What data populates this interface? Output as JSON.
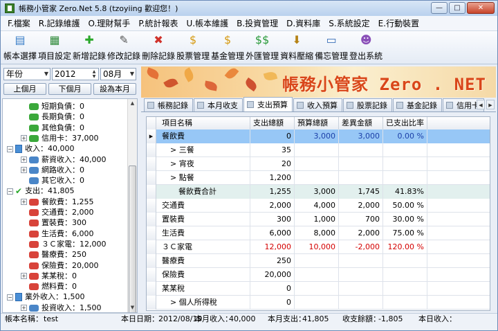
{
  "window": {
    "title": "帳務小管家 Zero.Net 5.8 (tzoyiing 歡迎您！)",
    "buttons": {
      "minimize": "—",
      "maximize": "□",
      "close": "✕"
    }
  },
  "menu": [
    "F.檔案",
    "R.記錄維護",
    "O.理財幫手",
    "P.統計報表",
    "U.帳本維護",
    "B.投資管理",
    "D.資料庫",
    "S.系統設定",
    "E.行動裝置"
  ],
  "toolbar": [
    {
      "label": "帳本選擇",
      "icon": "ledger-icon",
      "glyph": "▤",
      "color": "#3a7fc8"
    },
    {
      "label": "項目設定",
      "icon": "grid-settings-icon",
      "glyph": "▦",
      "color": "#2f8a3a"
    },
    {
      "label": "新增記錄",
      "icon": "add-record-icon",
      "glyph": "✚",
      "color": "#2aa82a"
    },
    {
      "label": "修改記錄",
      "icon": "edit-record-icon",
      "glyph": "✎",
      "color": "#555555"
    },
    {
      "label": "刪除記錄",
      "icon": "delete-record-icon",
      "glyph": "✖",
      "color": "#d0312a"
    },
    {
      "label": "股票管理",
      "icon": "stock-icon",
      "glyph": "$",
      "color": "#d69a12"
    },
    {
      "label": "基金管理",
      "icon": "fund-icon",
      "glyph": "$",
      "color": "#d69a12"
    },
    {
      "label": "外匯管理",
      "icon": "forex-icon",
      "glyph": "$$",
      "color": "#2a9a3a"
    },
    {
      "label": "資料壓縮",
      "icon": "compress-icon",
      "glyph": "⬇",
      "color": "#b58214"
    },
    {
      "label": "備忘管理",
      "icon": "memo-monitor-icon",
      "glyph": "▭",
      "color": "#3a6fb8"
    },
    {
      "label": "登出系統",
      "icon": "users-icon",
      "glyph": "☻",
      "color": "#8a4fb8"
    }
  ],
  "filters": {
    "period": "年份",
    "year": "2012",
    "month": "08月",
    "prev_month": "上個月",
    "next_month": "下個月",
    "this_month": "設為本月"
  },
  "tree": [
    {
      "text": "短期負債：0",
      "level": 2,
      "kind": "leaf-green"
    },
    {
      "text": "長期負債：0",
      "level": 2,
      "kind": "leaf-green"
    },
    {
      "text": "其他負債：0",
      "level": 2,
      "kind": "leaf-green"
    },
    {
      "text": "信用卡：37,000",
      "level": 2,
      "kind": "leaf-green",
      "expander": "+"
    },
    {
      "text": "收入：40,000",
      "level": 1,
      "kind": "folder-blue",
      "expander": "−"
    },
    {
      "text": "薪資收入：40,000",
      "level": 2,
      "kind": "leaf-blue",
      "expander": "+"
    },
    {
      "text": "網路收入：0",
      "level": 2,
      "kind": "leaf-blue",
      "expander": "+"
    },
    {
      "text": "其它收入：0",
      "level": 2,
      "kind": "leaf-blue"
    },
    {
      "text": "支出：41,805",
      "level": 1,
      "kind": "check-green",
      "expander": "−"
    },
    {
      "text": "餐飲費：1,255",
      "level": 2,
      "kind": "leaf-red",
      "expander": "+"
    },
    {
      "text": "交通費：2,000",
      "level": 2,
      "kind": "leaf-red"
    },
    {
      "text": "置裝費：300",
      "level": 2,
      "kind": "leaf-red"
    },
    {
      "text": "生活費：6,000",
      "level": 2,
      "kind": "leaf-red"
    },
    {
      "text": "３Ｃ家電：12,000",
      "level": 2,
      "kind": "leaf-red"
    },
    {
      "text": "醫療費：250",
      "level": 2,
      "kind": "leaf-red"
    },
    {
      "text": "保險費：20,000",
      "level": 2,
      "kind": "leaf-red"
    },
    {
      "text": "某某稅：0",
      "level": 2,
      "kind": "leaf-red",
      "expander": "+"
    },
    {
      "text": "燃料費：0",
      "level": 2,
      "kind": "leaf-red"
    },
    {
      "text": "業外收入：1,500",
      "level": 1,
      "kind": "folder-blue",
      "expander": "−"
    },
    {
      "text": "投資收入：1,500",
      "level": 2,
      "kind": "leaf-blue",
      "expander": "+"
    }
  ],
  "banner": {
    "title": "帳務小管家 Zero . NET"
  },
  "tabs": [
    {
      "label": "帳務記錄",
      "active": false
    },
    {
      "label": "本月收支",
      "active": false
    },
    {
      "label": "支出預算",
      "active": true
    },
    {
      "label": "收入預算",
      "active": false
    },
    {
      "label": "股票記錄",
      "active": false
    },
    {
      "label": "基金記錄",
      "active": false
    },
    {
      "label": "信用卡",
      "active": false
    }
  ],
  "grid": {
    "columns": [
      "項目名稱",
      "支出總額",
      "預算總額",
      "差異金額",
      "已支出比率"
    ],
    "rows": [
      {
        "name": "餐飲費",
        "spent": "0",
        "budget": "3,000",
        "diff": "3,000",
        "ratio": "0.00 %",
        "style": "selected",
        "indent": 0
      },
      {
        "name": "> 三餐",
        "spent": "35",
        "budget": "",
        "diff": "",
        "ratio": "",
        "style": "",
        "indent": 1
      },
      {
        "name": "> 宵夜",
        "spent": "20",
        "budget": "",
        "diff": "",
        "ratio": "",
        "style": "",
        "indent": 1
      },
      {
        "name": "> 點餐",
        "spent": "1,200",
        "budget": "",
        "diff": "",
        "ratio": "",
        "style": "",
        "indent": 1
      },
      {
        "name": "餐飲費合計",
        "spent": "1,255",
        "budget": "3,000",
        "diff": "1,745",
        "ratio": "41.83%",
        "style": "subtotal",
        "indent": 2
      },
      {
        "name": "交通費",
        "spent": "2,000",
        "budget": "4,000",
        "diff": "2,000",
        "ratio": "50.00 %",
        "style": "",
        "indent": 0
      },
      {
        "name": "置裝費",
        "spent": "300",
        "budget": "1,000",
        "diff": "700",
        "ratio": "30.00 %",
        "style": "",
        "indent": 0
      },
      {
        "name": "生活費",
        "spent": "6,000",
        "budget": "8,000",
        "diff": "2,000",
        "ratio": "75.00 %",
        "style": "",
        "indent": 0
      },
      {
        "name": "３Ｃ家電",
        "spent": "12,000",
        "budget": "10,000",
        "diff": "-2,000",
        "ratio": "120.00 %",
        "style": "over",
        "indent": 0
      },
      {
        "name": "醫療費",
        "spent": "250",
        "budget": "",
        "diff": "",
        "ratio": "",
        "style": "",
        "indent": 0
      },
      {
        "name": "保險費",
        "spent": "20,000",
        "budget": "",
        "diff": "",
        "ratio": "",
        "style": "",
        "indent": 0
      },
      {
        "name": "某某稅",
        "spent": "0",
        "budget": "",
        "diff": "",
        "ratio": "",
        "style": "",
        "indent": 0
      },
      {
        "name": "> 個人所得稅",
        "spent": "0",
        "budget": "",
        "diff": "",
        "ratio": "",
        "style": "",
        "indent": 1
      }
    ]
  },
  "status": {
    "ledger_label": "帳本名稱：",
    "ledger_value": "test",
    "date_label": "本日日期：",
    "date_value": "2012/08/19",
    "income_label": "本月收入：",
    "income_value": "40,000",
    "expense_label": "本月支出：",
    "expense_value": "41,805",
    "balance_label": "收支餘額：",
    "balance_value": "-1,805",
    "today_income_label": "本日收入："
  },
  "colors": {
    "selected_row": "#97c7f6",
    "subtotal_row": "#e2f0ee",
    "negative": "#d40000",
    "budget_blue": "#1b3fa8",
    "banner_title": "#d9461a"
  }
}
